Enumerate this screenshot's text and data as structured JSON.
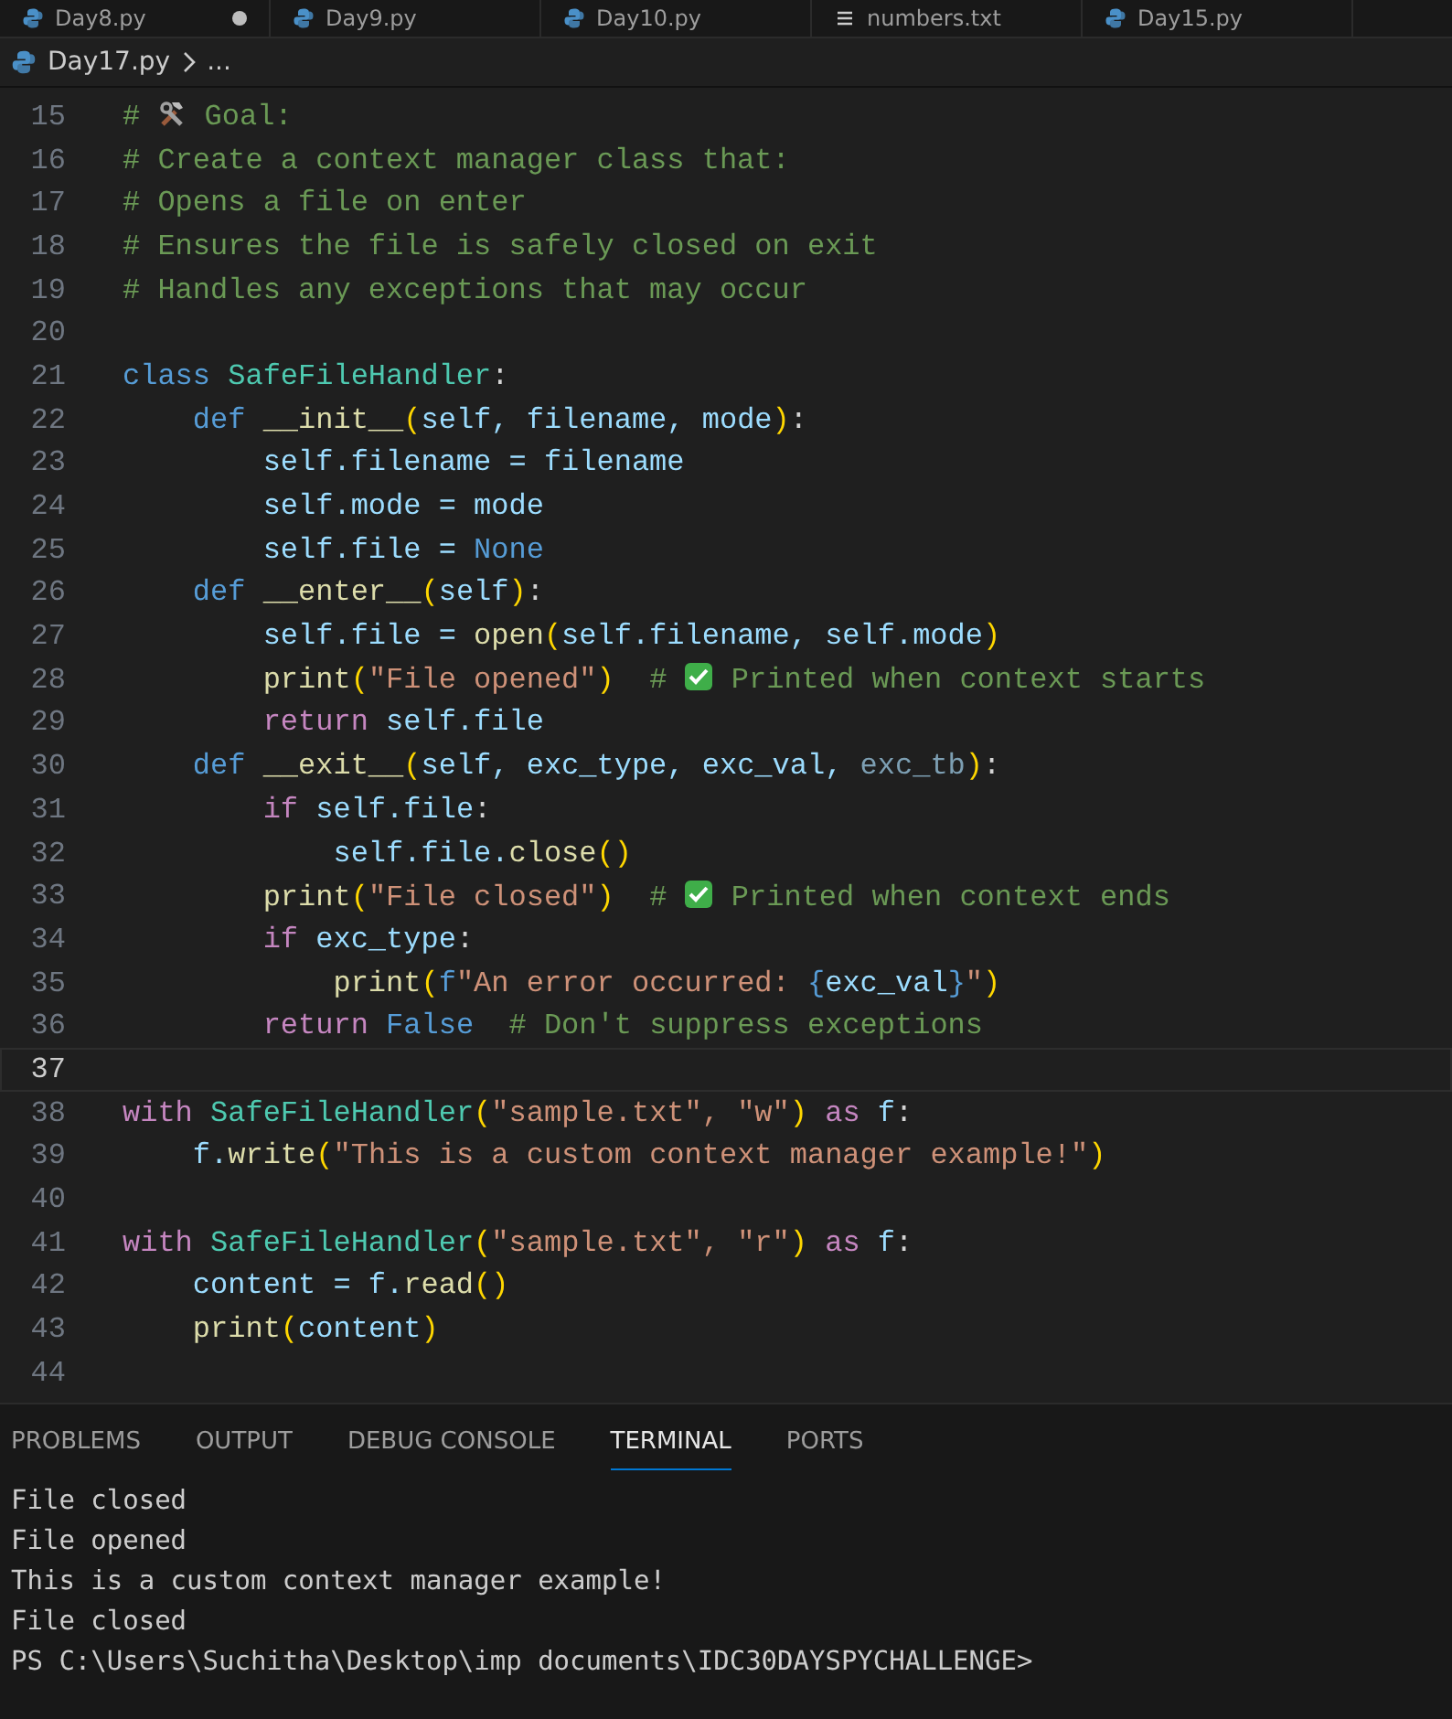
{
  "open_tabs": [
    {
      "label": "Day8.py",
      "kind": "python",
      "dirty": true
    },
    {
      "label": "Day9.py",
      "kind": "python",
      "dirty": false
    },
    {
      "label": "Day10.py",
      "kind": "python",
      "dirty": false
    },
    {
      "label": "numbers.txt",
      "kind": "text",
      "dirty": false
    },
    {
      "label": "Day15.py",
      "kind": "python",
      "dirty": false
    }
  ],
  "breadcrumb": {
    "file": "Day17.py",
    "rest": "..."
  },
  "code": [
    {
      "n": "15",
      "current": false,
      "tokens": [
        {
          "kind": "comment",
          "text": "# "
        },
        {
          "kind": "tools_icon"
        },
        {
          "kind": "comment",
          "text": " Goal:"
        }
      ]
    },
    {
      "n": "16",
      "current": false,
      "tokens": [
        {
          "kind": "comment",
          "text": "# Create a context manager class that:"
        }
      ]
    },
    {
      "n": "17",
      "current": false,
      "tokens": [
        {
          "kind": "comment",
          "text": "# Opens a file on enter"
        }
      ]
    },
    {
      "n": "18",
      "current": false,
      "tokens": [
        {
          "kind": "comment",
          "text": "# Ensures the file is safely closed on exit"
        }
      ]
    },
    {
      "n": "19",
      "current": false,
      "tokens": [
        {
          "kind": "comment",
          "text": "# Handles any exceptions that may occur"
        }
      ]
    },
    {
      "n": "20",
      "current": false
    },
    {
      "n": "21",
      "current": false,
      "tokens": [
        {
          "kind": "keyword",
          "text": "class "
        },
        {
          "kind": "class",
          "text": "SafeFileHandler"
        },
        {
          "kind": "plain",
          "text": ":"
        }
      ]
    },
    {
      "n": "22",
      "current": false,
      "tokens": [
        {
          "kind": "keyword",
          "text": "    def "
        },
        {
          "kind": "function",
          "text": "__init__"
        },
        {
          "kind": "bracket",
          "text": "("
        },
        {
          "kind": "variable",
          "text": "self, filename, mode"
        },
        {
          "kind": "bracket",
          "text": ")"
        },
        {
          "kind": "plain",
          "text": ":"
        }
      ]
    },
    {
      "n": "23",
      "current": false,
      "tokens": [
        {
          "kind": "variable",
          "text": "        self.filename = filename"
        }
      ]
    },
    {
      "n": "24",
      "current": false,
      "tokens": [
        {
          "kind": "variable",
          "text": "        self.mode = mode"
        }
      ]
    },
    {
      "n": "25",
      "current": false,
      "tokens": [
        {
          "kind": "variable",
          "text": "        self.file = "
        },
        {
          "kind": "keyword",
          "text": "None"
        }
      ]
    },
    {
      "n": "26",
      "current": false,
      "tokens": [
        {
          "kind": "keyword",
          "text": "    def "
        },
        {
          "kind": "function",
          "text": "__enter__"
        },
        {
          "kind": "bracket",
          "text": "("
        },
        {
          "kind": "variable",
          "text": "self"
        },
        {
          "kind": "bracket",
          "text": ")"
        },
        {
          "kind": "plain",
          "text": ":"
        }
      ]
    },
    {
      "n": "27",
      "current": false,
      "tokens": [
        {
          "kind": "variable",
          "text": "        self.file = "
        },
        {
          "kind": "function",
          "text": "open"
        },
        {
          "kind": "bracket",
          "text": "("
        },
        {
          "kind": "variable",
          "text": "self.filename, self.mode"
        },
        {
          "kind": "bracket",
          "text": ")"
        }
      ]
    },
    {
      "n": "28",
      "current": false,
      "tokens": [
        {
          "kind": "function",
          "text": "        print"
        },
        {
          "kind": "bracket",
          "text": "("
        },
        {
          "kind": "string",
          "text": "\"File opened\""
        },
        {
          "kind": "bracket",
          "text": ")"
        },
        {
          "kind": "comment",
          "text": "  # "
        },
        {
          "kind": "check_icon"
        },
        {
          "kind": "comment",
          "text": " Printed when context starts"
        }
      ]
    },
    {
      "n": "29",
      "current": false,
      "tokens": [
        {
          "kind": "control",
          "text": "        return "
        },
        {
          "kind": "variable",
          "text": "self.file"
        }
      ]
    },
    {
      "n": "30",
      "current": false,
      "tokens": [
        {
          "kind": "keyword",
          "text": "    def "
        },
        {
          "kind": "function",
          "text": "__exit__"
        },
        {
          "kind": "bracket",
          "text": "("
        },
        {
          "kind": "variable",
          "text": "self, exc_type, exc_val, "
        },
        {
          "kind": "unused",
          "text": "exc_tb"
        },
        {
          "kind": "bracket",
          "text": ")"
        },
        {
          "kind": "plain",
          "text": ":"
        }
      ]
    },
    {
      "n": "31",
      "current": false,
      "tokens": [
        {
          "kind": "control",
          "text": "        if "
        },
        {
          "kind": "variable",
          "text": "self.file"
        },
        {
          "kind": "plain",
          "text": ":"
        }
      ]
    },
    {
      "n": "32",
      "current": false,
      "tokens": [
        {
          "kind": "variable",
          "text": "            self.file."
        },
        {
          "kind": "function",
          "text": "close"
        },
        {
          "kind": "bracket",
          "text": "()"
        }
      ]
    },
    {
      "n": "33",
      "current": false,
      "tokens": [
        {
          "kind": "function",
          "text": "        print"
        },
        {
          "kind": "bracket",
          "text": "("
        },
        {
          "kind": "string",
          "text": "\"File closed\""
        },
        {
          "kind": "bracket",
          "text": ")"
        },
        {
          "kind": "comment",
          "text": "  # "
        },
        {
          "kind": "check_icon"
        },
        {
          "kind": "comment",
          "text": " Printed when context ends"
        }
      ]
    },
    {
      "n": "34",
      "current": false,
      "tokens": [
        {
          "kind": "control",
          "text": "        if "
        },
        {
          "kind": "variable",
          "text": "exc_type"
        },
        {
          "kind": "plain",
          "text": ":"
        }
      ]
    },
    {
      "n": "35",
      "current": false,
      "tokens": [
        {
          "kind": "function",
          "text": "            print"
        },
        {
          "kind": "bracket",
          "text": "("
        },
        {
          "kind": "keyword",
          "text": "f"
        },
        {
          "kind": "string",
          "text": "\"An error occurred: "
        },
        {
          "kind": "keyword",
          "text": "{"
        },
        {
          "kind": "variable",
          "text": "exc_val"
        },
        {
          "kind": "keyword",
          "text": "}"
        },
        {
          "kind": "string",
          "text": "\""
        },
        {
          "kind": "bracket",
          "text": ")"
        }
      ]
    },
    {
      "n": "36",
      "current": false,
      "tokens": [
        {
          "kind": "control",
          "text": "        return "
        },
        {
          "kind": "keyword",
          "text": "False"
        },
        {
          "kind": "comment",
          "text": "  # Don't suppress exceptions"
        }
      ]
    },
    {
      "n": "37",
      "current": true
    },
    {
      "n": "38",
      "current": false,
      "tokens": [
        {
          "kind": "control",
          "text": "with "
        },
        {
          "kind": "class",
          "text": "SafeFileHandler"
        },
        {
          "kind": "bracket",
          "text": "("
        },
        {
          "kind": "string",
          "text": "\"sample.txt\", \"w\""
        },
        {
          "kind": "bracket",
          "text": ")"
        },
        {
          "kind": "control",
          "text": " as "
        },
        {
          "kind": "variable",
          "text": "f"
        },
        {
          "kind": "plain",
          "text": ":"
        }
      ]
    },
    {
      "n": "39",
      "current": false,
      "tokens": [
        {
          "kind": "variable",
          "text": "    f."
        },
        {
          "kind": "function",
          "text": "write"
        },
        {
          "kind": "bracket",
          "text": "("
        },
        {
          "kind": "string",
          "text": "\"This is a custom context manager example!\""
        },
        {
          "kind": "bracket",
          "text": ")"
        }
      ]
    },
    {
      "n": "40",
      "current": false
    },
    {
      "n": "41",
      "current": false,
      "tokens": [
        {
          "kind": "control",
          "text": "with "
        },
        {
          "kind": "class",
          "text": "SafeFileHandler"
        },
        {
          "kind": "bracket",
          "text": "("
        },
        {
          "kind": "string",
          "text": "\"sample.txt\", \"r\""
        },
        {
          "kind": "bracket",
          "text": ")"
        },
        {
          "kind": "control",
          "text": " as "
        },
        {
          "kind": "variable",
          "text": "f"
        },
        {
          "kind": "plain",
          "text": ":"
        }
      ]
    },
    {
      "n": "42",
      "current": false,
      "tokens": [
        {
          "kind": "variable",
          "text": "    content = f."
        },
        {
          "kind": "function",
          "text": "read"
        },
        {
          "kind": "bracket",
          "text": "()"
        }
      ]
    },
    {
      "n": "43",
      "current": false,
      "tokens": [
        {
          "kind": "function",
          "text": "    print"
        },
        {
          "kind": "bracket",
          "text": "("
        },
        {
          "kind": "variable",
          "text": "content"
        },
        {
          "kind": "bracket",
          "text": ")"
        }
      ]
    },
    {
      "n": "44",
      "current": false
    }
  ],
  "panel_tabs": [
    {
      "label": "PROBLEMS",
      "selected": false
    },
    {
      "label": "OUTPUT",
      "selected": false
    },
    {
      "label": "DEBUG CONSOLE",
      "selected": false
    },
    {
      "label": "TERMINAL",
      "selected": true
    },
    {
      "label": "PORTS",
      "selected": false
    }
  ],
  "terminal": [
    "File closed",
    "File opened",
    "This is a custom context manager example!",
    "File closed",
    "PS C:\\Users\\Suchitha\\Desktop\\imp documents\\IDC30DAYSPYCHALLENGE>"
  ]
}
